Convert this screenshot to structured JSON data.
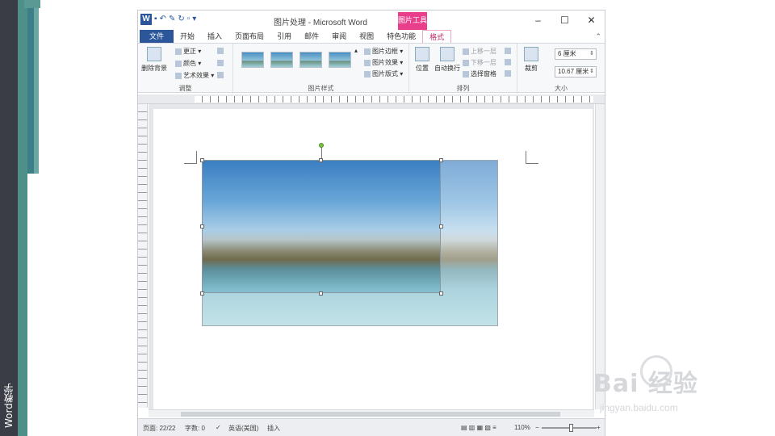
{
  "side": {
    "caption": "Word教学"
  },
  "titlebar": {
    "word_logo": "W",
    "title": "图片处理 - Microsoft Word",
    "context_tab": "图片工具",
    "minimize": "–",
    "restore": "☐",
    "close": "✕"
  },
  "tabs": {
    "file": "文件",
    "home": "开始",
    "insert": "插入",
    "layout": "页面布局",
    "references": "引用",
    "mailings": "邮件",
    "review": "审阅",
    "view": "视图",
    "special": "特色功能",
    "format": "格式",
    "collapse": "⌃"
  },
  "ribbon": {
    "adjust": {
      "remove_bg": "删除背景",
      "corrections": "更正",
      "color": "颜色",
      "artistic": "艺术效果",
      "label": "调整"
    },
    "styles": {
      "border": "图片边框",
      "effects": "图片效果",
      "layout": "图片版式",
      "label": "图片样式"
    },
    "arrange": {
      "position": "位置",
      "wrap": "自动换行",
      "bring_forward": "上移一层",
      "send_backward": "下移一层",
      "selection_pane": "选择窗格",
      "label": "排列"
    },
    "size": {
      "crop": "裁剪",
      "height": "6 厘米",
      "width": "10.67 厘米",
      "label": "大小"
    }
  },
  "ruler": {
    "marks": "4 2 2 4 6 8 10 12 14 16 18 20 22 24 26 28 30 32 34 36 38 40 42 44 46 48"
  },
  "status": {
    "page": "页面: 22/22",
    "words": "字数: 0",
    "language": "英语(美国)",
    "mode": "插入",
    "zoom": "110%",
    "zoom_minus": "−",
    "zoom_plus": "+"
  },
  "watermark": {
    "main": "Bai 经验",
    "sub": "jingyan.baidu.com"
  }
}
